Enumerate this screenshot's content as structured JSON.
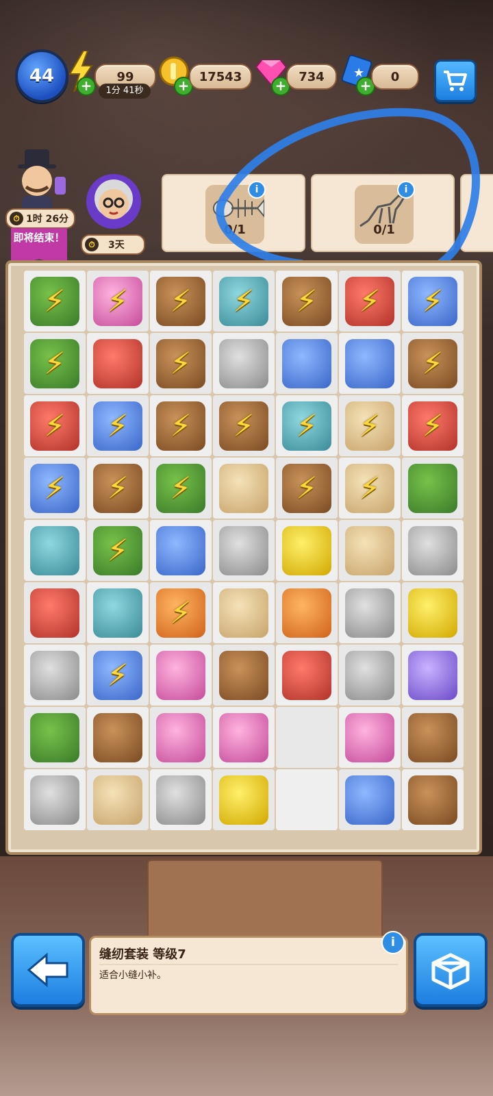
{
  "hud": {
    "level": "44",
    "energy": "99",
    "energy_timer": "1分 41秒",
    "coins": "17543",
    "gems": "734",
    "cards": "0",
    "colors": {
      "energy": "#ffd83a",
      "coin": "#f7c12b",
      "gem": "#ff4fb0",
      "card": "#2b7be6"
    }
  },
  "event": {
    "host_timer": "1时 26分",
    "ending_label": "即将结束！",
    "granny_timer": "3天",
    "quests": [
      {
        "count": "0/1",
        "item": "fish-skeleton"
      },
      {
        "count": "0/1",
        "item": "dinosaur-skeleton"
      }
    ]
  },
  "board": {
    "rows": [
      [
        {
          "c": "c-green",
          "bolt": true
        },
        {
          "c": "c-pink",
          "bolt": true
        },
        {
          "c": "c-brown",
          "bolt": true
        },
        {
          "c": "c-teal",
          "bolt": true
        },
        {
          "c": "c-brown",
          "bolt": true
        },
        {
          "c": "c-red",
          "bolt": true
        },
        {
          "c": "c-blue",
          "bolt": true
        }
      ],
      [
        {
          "c": "c-green",
          "bolt": true
        },
        {
          "c": "c-red",
          "bolt": false
        },
        {
          "c": "c-brown",
          "bolt": true
        },
        {
          "c": "c-gray",
          "bolt": false
        },
        {
          "c": "c-blue",
          "bolt": false
        },
        {
          "c": "c-blue",
          "bolt": false
        },
        {
          "c": "c-brown",
          "bolt": true
        }
      ],
      [
        {
          "c": "c-red",
          "bolt": true
        },
        {
          "c": "c-blue",
          "bolt": true
        },
        {
          "c": "c-brown",
          "bolt": true
        },
        {
          "c": "c-brown",
          "bolt": true
        },
        {
          "c": "c-teal",
          "bolt": true
        },
        {
          "c": "c-cream",
          "bolt": true
        },
        {
          "c": "c-red",
          "bolt": true
        }
      ],
      [
        {
          "c": "c-blue",
          "bolt": true
        },
        {
          "c": "c-brown",
          "bolt": true
        },
        {
          "c": "c-green",
          "bolt": true
        },
        {
          "c": "c-cream",
          "bolt": false
        },
        {
          "c": "c-brown",
          "bolt": true
        },
        {
          "c": "c-cream",
          "bolt": true
        },
        {
          "c": "c-green",
          "bolt": false
        }
      ],
      [
        {
          "c": "c-teal",
          "bolt": false
        },
        {
          "c": "c-green",
          "bolt": true
        },
        {
          "c": "c-blue",
          "bolt": false
        },
        {
          "c": "c-gray",
          "bolt": false
        },
        {
          "c": "c-yellow",
          "bolt": false
        },
        {
          "c": "c-cream",
          "bolt": false
        },
        {
          "c": "c-gray",
          "bolt": false
        }
      ],
      [
        {
          "c": "c-red",
          "bolt": false
        },
        {
          "c": "c-teal",
          "bolt": false
        },
        {
          "c": "c-orange",
          "bolt": true
        },
        {
          "c": "c-cream",
          "bolt": false
        },
        {
          "c": "c-orange",
          "bolt": false
        },
        {
          "c": "c-gray",
          "bolt": false
        },
        {
          "c": "c-yellow",
          "bolt": false
        }
      ],
      [
        {
          "c": "c-gray",
          "bolt": false
        },
        {
          "c": "c-blue",
          "bolt": true
        },
        {
          "c": "c-pink",
          "bolt": false
        },
        {
          "c": "c-brown",
          "bolt": false
        },
        {
          "c": "c-red",
          "bolt": false
        },
        {
          "c": "c-gray",
          "bolt": false
        },
        {
          "c": "c-purple",
          "bolt": false
        }
      ],
      [
        {
          "c": "c-green",
          "bolt": false
        },
        {
          "c": "c-brown",
          "bolt": false
        },
        {
          "c": "c-pink",
          "bolt": false
        },
        {
          "c": "c-pink",
          "bolt": false
        },
        {
          "c": "c-empty",
          "bolt": false
        },
        {
          "c": "c-pink",
          "bolt": false
        },
        {
          "c": "c-brown",
          "bolt": false
        }
      ],
      [
        {
          "c": "c-gray",
          "bolt": false
        },
        {
          "c": "c-cream",
          "bolt": false
        },
        {
          "c": "c-gray",
          "bolt": false
        },
        {
          "c": "c-yellow",
          "bolt": false
        },
        {
          "c": "c-empty",
          "bolt": false
        },
        {
          "c": "c-blue",
          "bolt": false
        },
        {
          "c": "c-brown",
          "bolt": false
        }
      ]
    ]
  },
  "info": {
    "title": "缝纫套装 等级7",
    "desc": "适合小缝小补。"
  }
}
